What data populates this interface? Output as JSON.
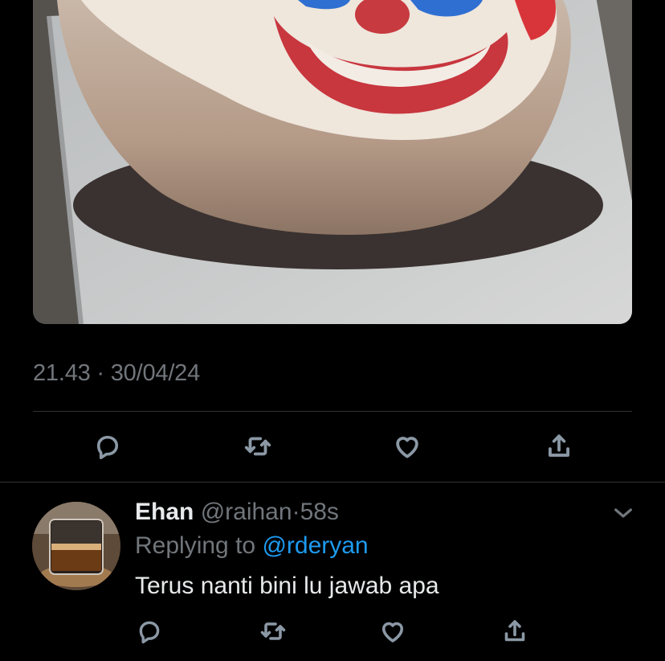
{
  "tweet": {
    "timestamp": "21.43 · 30/04/24",
    "media": {
      "description_icon": "clown-cake-photo"
    },
    "actions": [
      {
        "name": "reply",
        "icon": "reply-icon"
      },
      {
        "name": "retweet",
        "icon": "retweet-icon"
      },
      {
        "name": "like",
        "icon": "heart-icon"
      },
      {
        "name": "share",
        "icon": "share-icon"
      }
    ]
  },
  "reply": {
    "name": "Ehan",
    "handle": "@raihan",
    "separator": "·",
    "time": "58s",
    "replying_prefix": "Replying to",
    "replying_to": "@rderyan",
    "text": "Terus nanti bini lu jawab apa",
    "avatar_icon": "coffee-glass-avatar",
    "more_icon": "chevron-down-icon",
    "actions": [
      {
        "name": "reply",
        "icon": "reply-icon"
      },
      {
        "name": "retweet",
        "icon": "retweet-icon"
      },
      {
        "name": "like",
        "icon": "heart-icon"
      },
      {
        "name": "share",
        "icon": "share-icon"
      }
    ]
  },
  "colors": {
    "background": "#000000",
    "text_primary": "#e7e9ea",
    "text_secondary": "#71767b",
    "accent": "#1d9bf0",
    "icon": "#8b98a5",
    "divider": "#2f3336"
  }
}
